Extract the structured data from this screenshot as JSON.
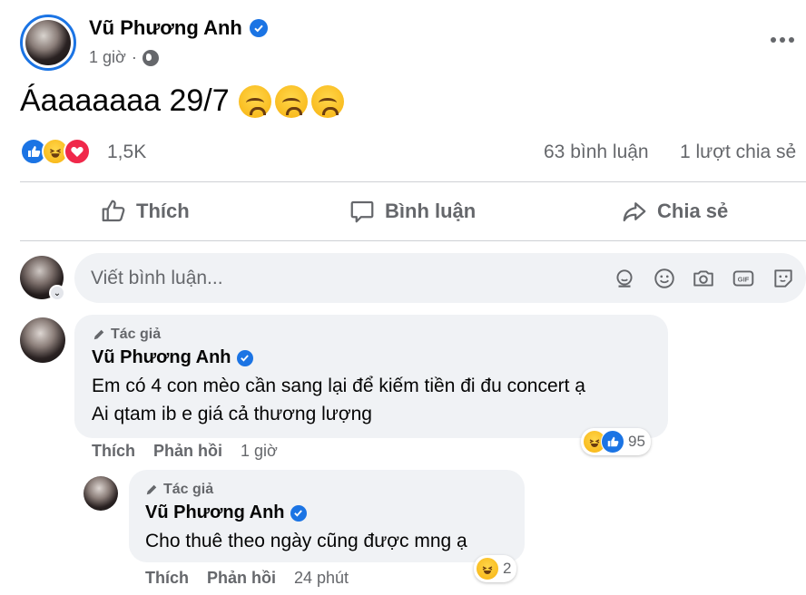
{
  "post": {
    "author": "Vũ Phương Anh",
    "time": "1 giờ",
    "text": "Áaaaaaaa 29/7",
    "emoji": [
      "crying-face",
      "crying-face",
      "crying-face"
    ]
  },
  "stats": {
    "reactions": "1,5K",
    "comments": "63 bình luận",
    "shares": "1 lượt chia sẻ"
  },
  "actions": {
    "like": "Thích",
    "comment": "Bình luận",
    "share": "Chia sẻ"
  },
  "composer": {
    "placeholder": "Viết bình luận..."
  },
  "comments": [
    {
      "badge": "Tác giả",
      "name": "Vũ Phương Anh",
      "line1": "Em có 4 con mèo cần sang lại để kiếm tiền đi đu concert ạ",
      "line2": "Ai qtam ib e giá cả thương lượng",
      "like": "Thích",
      "reply": "Phản hồi",
      "time": "1 giờ",
      "reaction_count": "95"
    },
    {
      "badge": "Tác giả",
      "name": "Vũ Phương Anh",
      "line1": "Cho thuê theo ngày cũng được mng ạ",
      "like": "Thích",
      "reply": "Phản hồi",
      "time": "24 phút",
      "reaction_count": "2"
    }
  ],
  "colors": {
    "brand": "#1b74e4",
    "love": "#f0284a",
    "muted": "#65676b",
    "bubble": "#f0f2f5"
  }
}
